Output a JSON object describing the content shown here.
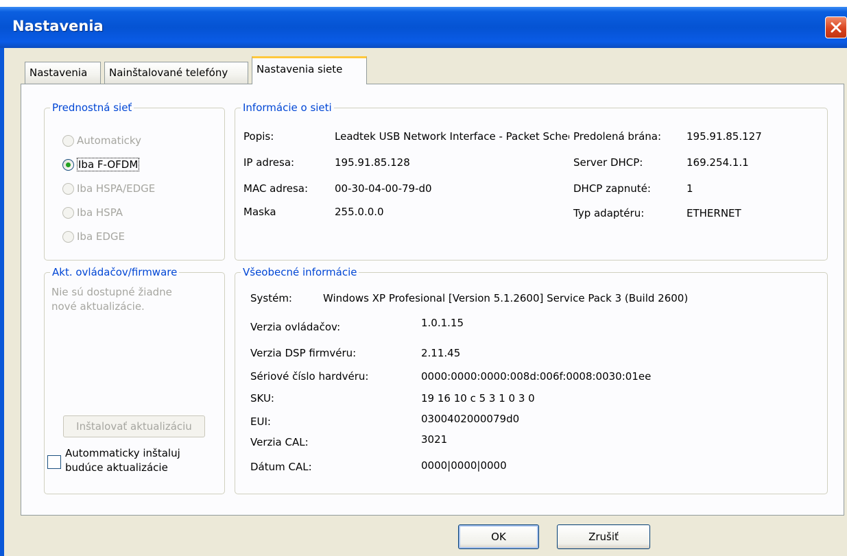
{
  "window": {
    "title": "Nastavenia"
  },
  "tabs": [
    {
      "label": "Nastavenia"
    },
    {
      "label": "Nainštalované telefóny"
    },
    {
      "label": "Nastavenia siete"
    }
  ],
  "preferred_network": {
    "title": "Prednostná sieť",
    "options": [
      {
        "label": "Automaticky",
        "enabled": false,
        "checked": false
      },
      {
        "label": "Iba F-OFDM",
        "enabled": true,
        "checked": true
      },
      {
        "label": "Iba HSPA/EDGE",
        "enabled": false,
        "checked": false
      },
      {
        "label": "Iba HSPA",
        "enabled": false,
        "checked": false
      },
      {
        "label": "Iba EDGE",
        "enabled": false,
        "checked": false
      }
    ]
  },
  "network_info": {
    "title": "Informácie o sieti",
    "description_label": "Popis:",
    "description_value": "Leadtek USB Network Interface - Packet Scheduler Miniport",
    "ip_label": "IP adresa:",
    "ip_value": "195.91.85.128",
    "mac_label": "MAC adresa:",
    "mac_value": "00-30-04-00-79-d0",
    "mask_label": "Maska",
    "mask_value": "255.0.0.0",
    "gateway_label": "Predolená brána:",
    "gateway_value": "195.91.85.127",
    "dhcp_server_label": "Server DHCP:",
    "dhcp_server_value": "169.254.1.1",
    "dhcp_enabled_label": "DHCP zapnuté:",
    "dhcp_enabled_value": "1",
    "adapter_type_label": "Typ adaptéru:",
    "adapter_type_value": "ETHERNET"
  },
  "firmware": {
    "title": "Akt. ovládačov/firmware",
    "status": "Nie sú dostupné žiadne nové aktualizácie.",
    "install_button": "Inštalovať aktualizáciu",
    "auto_install_label": "Autommaticky inštaluj budúce aktualizácie"
  },
  "general_info": {
    "title": "Všeobecné informácie",
    "system_label": "Systém:",
    "system_value": "Windows XP Profesional [Version 5.1.2600] Service Pack 3 (Build 2600)",
    "rows": [
      {
        "label": "Verzia ovládačov:",
        "value": "1.0.1.15"
      },
      {
        "label": "Verzia DSP firmvéru:",
        "value": "2.11.45"
      },
      {
        "label": "Sériové číslo hardvéru:",
        "value": "0000:0000:0000:008d:006f:0008:0030:01ee"
      },
      {
        "label": "SKU:",
        "value": "19 16 10 c 5 3 1 0 3 0"
      },
      {
        "label": "EUI:",
        "value": "0300402000079d0"
      },
      {
        "label": "Verzia CAL:",
        "value": "3021"
      },
      {
        "label": "Dátum CAL:",
        "value": "0000|0000|0000"
      }
    ]
  },
  "buttons": {
    "ok": "OK",
    "cancel": "Zrušiť"
  }
}
